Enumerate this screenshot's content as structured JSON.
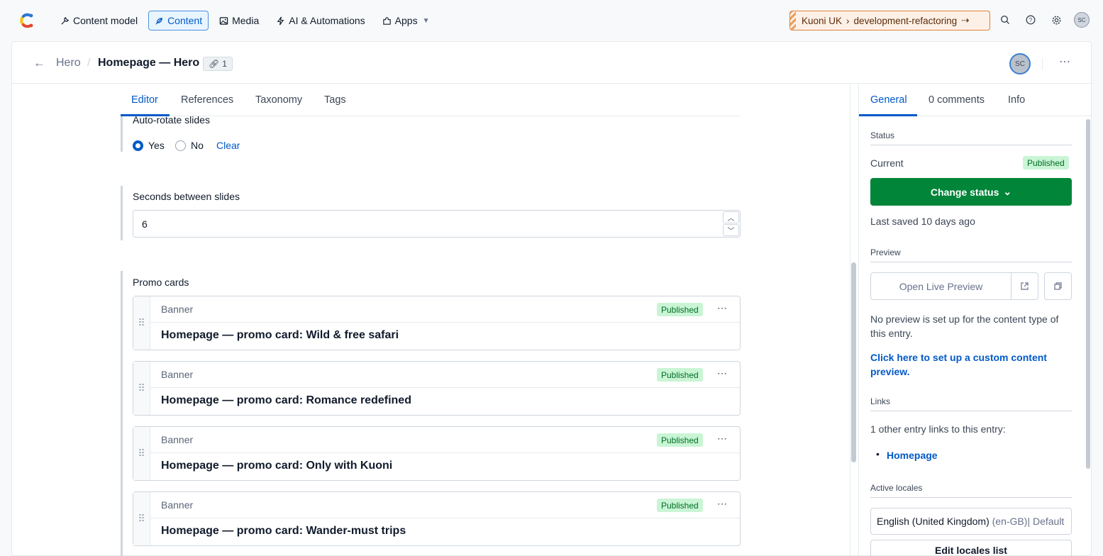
{
  "topnav": {
    "items": [
      {
        "label": "Content model",
        "icon": "wrench-icon"
      },
      {
        "label": "Content",
        "icon": "feather-icon",
        "active": true
      },
      {
        "label": "Media",
        "icon": "image-icon"
      },
      {
        "label": "AI & Automations",
        "icon": "bolt-icon"
      },
      {
        "label": "Apps",
        "icon": "puzzle-icon"
      }
    ],
    "env_space": "Kuoni UK",
    "env_name": "development-refactoring",
    "user_initials": "SC"
  },
  "header": {
    "crumb_parent": "Hero",
    "title": "Homepage — Hero",
    "link_count": "1",
    "user_initials": "SC"
  },
  "editor": {
    "tabs": [
      "Editor",
      "References",
      "Taxonomy",
      "Tags"
    ],
    "autorotate": {
      "label": "Auto-rotate slides",
      "yes": "Yes",
      "no": "No",
      "clear": "Clear",
      "selected": "Yes"
    },
    "seconds": {
      "label": "Seconds between slides",
      "value": "6"
    },
    "promo": {
      "label": "Promo cards",
      "cards": [
        {
          "type": "Banner",
          "status": "Published",
          "title": "Homepage — promo card: Wild & free safari"
        },
        {
          "type": "Banner",
          "status": "Published",
          "title": "Homepage — promo card: Romance redefined"
        },
        {
          "type": "Banner",
          "status": "Published",
          "title": "Homepage — promo card: Only with Kuoni"
        },
        {
          "type": "Banner",
          "status": "Published",
          "title": "Homepage — promo card: Wander-must trips"
        }
      ]
    }
  },
  "sidebar": {
    "tabs": [
      "General",
      "0 comments",
      "Info"
    ],
    "status_heading": "Status",
    "current_label": "Current",
    "current_status": "Published",
    "change_status": "Change status",
    "last_saved": "Last saved 10 days ago",
    "preview_heading": "Preview",
    "open_preview": "Open Live Preview",
    "no_preview_text": "No preview is set up for the content type of this entry.",
    "setup_link": "Click here to set up a custom content preview.",
    "links_heading": "Links",
    "links_text": "1 other entry links to this entry:",
    "linked_entry": "Homepage",
    "locales_heading": "Active locales",
    "locale_name": "English (United Kingdom)",
    "locale_code": "(en-GB)",
    "locale_default": "| Default",
    "edit_locales": "Edit locales list"
  },
  "colors": {
    "accent": "#0059c8",
    "published_bg": "#c9f5d5",
    "published_text": "#006d23",
    "change_status_bg": "#008539",
    "env_bg": "#fdf1e7",
    "env_border": "#e07f3a"
  }
}
